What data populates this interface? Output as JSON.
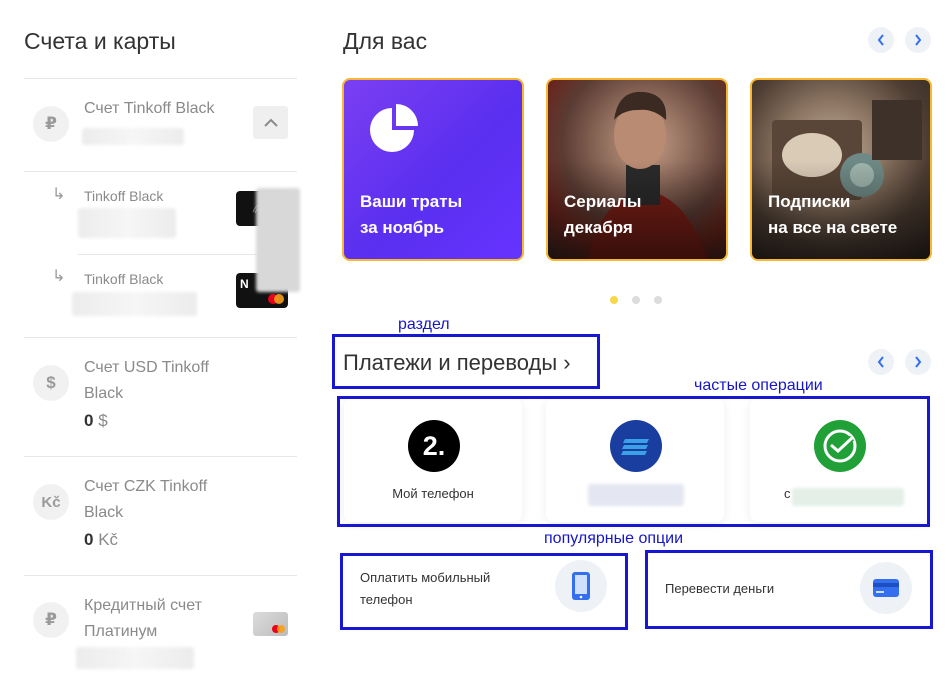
{
  "accounts_section": {
    "title": "Счета и карты",
    "main_account": {
      "icon": "₽",
      "name": "Счет Tinkoff Black"
    },
    "sub_cards": [
      {
        "name": "Tinkoff Black",
        "card_letter": ""
      },
      {
        "name": "Tinkoff Black",
        "card_letter": "N"
      }
    ],
    "usd_account": {
      "icon": "$",
      "name_line1": "Счет USD Tinkoff",
      "name_line2": "Black",
      "amount": "0",
      "currency": "$"
    },
    "czk_account": {
      "icon": "Kč",
      "name_line1": "Счет CZK Tinkoff",
      "name_line2": "Black",
      "amount": "0",
      "currency": "Kč"
    },
    "credit_account": {
      "icon": "₽",
      "name_line1": "Кредитный счет",
      "name_line2": "Платинум"
    }
  },
  "for_you": {
    "title": "Для вас",
    "promos": [
      {
        "line1": "Ваши траты",
        "line2": "за ноябрь"
      },
      {
        "line1": "Сериалы",
        "line2": "декабря"
      },
      {
        "line1": "Подписки",
        "line2": "на все на свете"
      }
    ],
    "active_dot": 1
  },
  "payments": {
    "title": "Платежи и переводы ›",
    "frequent": [
      {
        "label": "Мой телефон",
        "logo_text": "2."
      },
      {
        "label": ""
      },
      {
        "label": "с"
      }
    ],
    "popular": [
      {
        "line1": "Оплатить мобильный",
        "line2": "телефон"
      },
      {
        "line1": "Перевести деньги",
        "line2": ""
      }
    ]
  },
  "annotations": {
    "section": "раздел",
    "frequent": "частые операции",
    "popular": "популярные опции"
  },
  "colors": {
    "accent_blue": "#336fee",
    "annotation_blue": "#1717d1",
    "promo_border": "#f7b733",
    "active_dot": "#f8d74a"
  }
}
